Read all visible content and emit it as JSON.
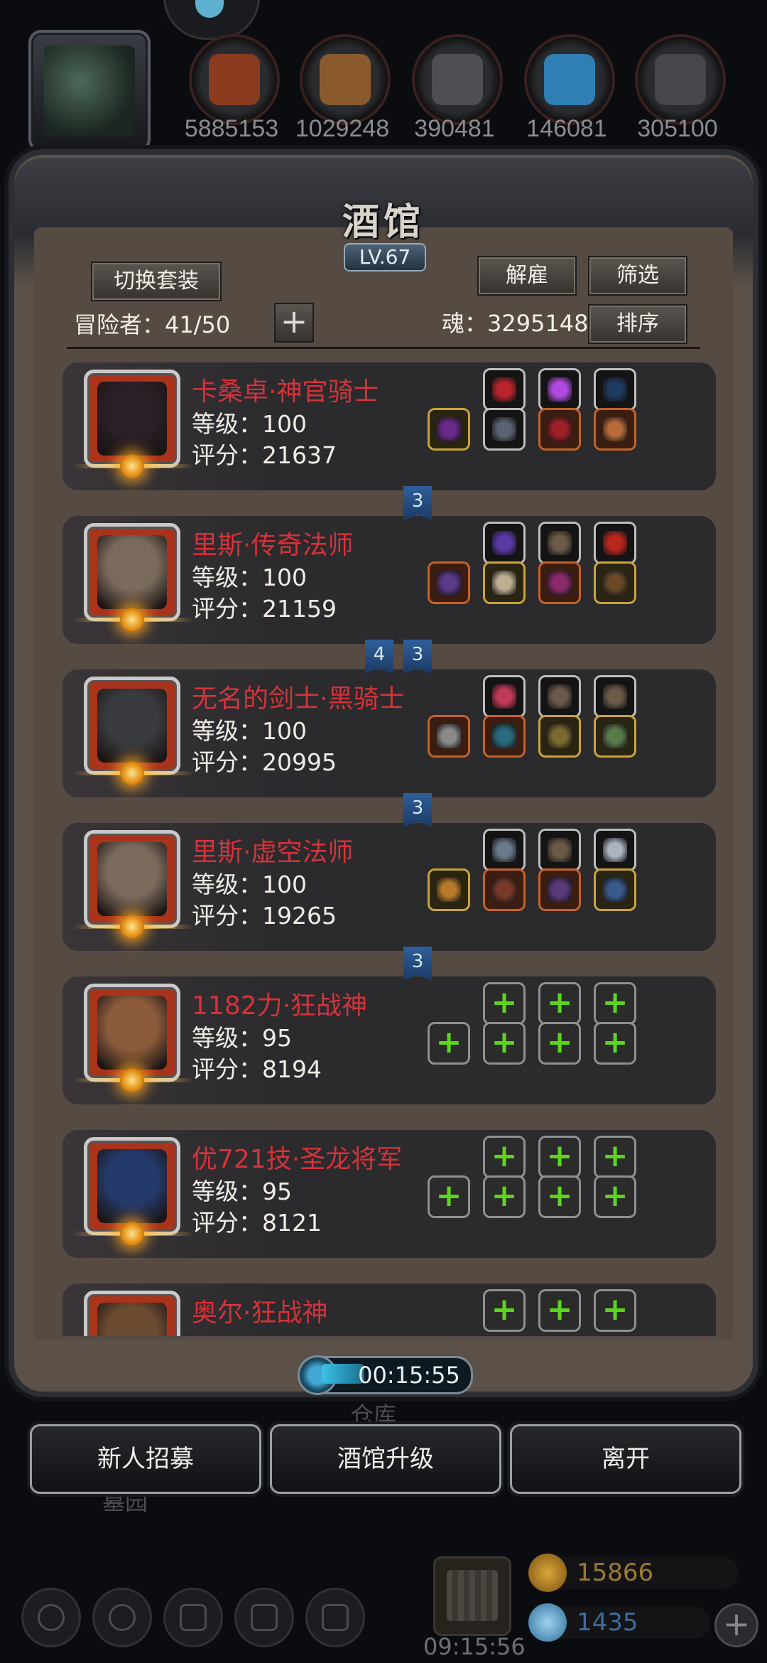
{
  "resources": {
    "values": [
      "5885153",
      "1029248",
      "390481",
      "146081",
      "305100"
    ],
    "icons": [
      "meat-icon",
      "wood-icon",
      "stone-icon",
      "crystal-icon",
      "iron-icon"
    ],
    "colors": [
      "#8a3b1e",
      "#8a5a2e",
      "#4e4f53",
      "#2f7fb5",
      "#45474b"
    ]
  },
  "panel": {
    "title": "酒馆",
    "level": "LV.67",
    "switch_set": "切换套装",
    "dismiss": "解雇",
    "filter": "筛选",
    "sort": "排序",
    "adventurers": "冒险者：41/50",
    "soul": "魂：3295148"
  },
  "heroes": [
    {
      "name": "卡桑卓·神官骑士",
      "level": "等级：100",
      "score": "评分：21637",
      "face": "#2a1f26",
      "top": [
        {
          "t": "",
          "c": "#b8242b"
        },
        {
          "t": "",
          "c": "#b04ae0"
        },
        {
          "t": "",
          "c": "#1e3a5e"
        }
      ],
      "bottom": [
        {
          "t": "gold",
          "c": "#6a2a8a"
        },
        {
          "t": "",
          "c": "#5b6272"
        },
        {
          "t": "red",
          "c": "#a01e28"
        },
        {
          "t": "red",
          "c": "#b86a3a"
        }
      ]
    },
    {
      "name": "里斯·传奇法师",
      "level": "等级：100",
      "score": "评分：21159",
      "face": "#7a6a5c",
      "top": [
        {
          "t": "",
          "c": "#5a3aa8"
        },
        {
          "t": "",
          "c": "#6b5a48"
        },
        {
          "t": "",
          "c": "#b8261e"
        }
      ],
      "bottom": [
        {
          "t": "red",
          "c": "#5a3a8a"
        },
        {
          "t": "gold",
          "c": "#bfae92"
        },
        {
          "t": "red",
          "c": "#8a2a6a"
        },
        {
          "t": "gold",
          "c": "#6a4a26"
        }
      ]
    },
    {
      "name": "无名的剑士·黑骑士",
      "level": "等级：100",
      "score": "评分：20995",
      "face": "#3a3b3f",
      "top": [
        {
          "t": "",
          "c": "#c23a5a"
        },
        {
          "t": "",
          "c": "#6b5a48"
        },
        {
          "t": "",
          "c": "#6b5a48"
        }
      ],
      "bottom": [
        {
          "t": "red",
          "c": "#8a8a8a"
        },
        {
          "t": "red",
          "c": "#2a6a7a"
        },
        {
          "t": "gold",
          "c": "#7a6a30"
        },
        {
          "t": "gold",
          "c": "#5a7a4a"
        }
      ]
    },
    {
      "name": "里斯·虚空法师",
      "level": "等级：100",
      "score": "评分：19265",
      "face": "#7a6a5c",
      "top": [
        {
          "t": "",
          "c": "#6a7a8a"
        },
        {
          "t": "",
          "c": "#6b5a48"
        },
        {
          "t": "",
          "c": "#aab4c0"
        }
      ],
      "bottom": [
        {
          "t": "gold",
          "c": "#b87a2a"
        },
        {
          "t": "red",
          "c": "#7a3a2a"
        },
        {
          "t": "red",
          "c": "#5a3a7a"
        },
        {
          "t": "gold",
          "c": "#3a5a8a"
        }
      ]
    },
    {
      "name": "1182力·狂战神",
      "level": "等级：95",
      "score": "评分：8194",
      "face": "#8a5a3a"
    },
    {
      "name": "优721技·圣龙将军",
      "level": "等级：95",
      "score": "评分：8121",
      "face": "#243a6a"
    },
    {
      "name": "奥尔·狂战神",
      "level": "",
      "score": "",
      "face": "#6a4a30"
    }
  ],
  "badges": [
    {
      "labels": [
        "3"
      ]
    },
    {
      "labels": [
        "4",
        "3"
      ]
    },
    {
      "labels": [
        "3"
      ]
    },
    {
      "labels": [
        "3"
      ]
    }
  ],
  "timer": "00:15:55",
  "background_labels": {
    "warehouse": "仓库",
    "cemetery": "墓园"
  },
  "buttons": {
    "recruit": "新人招募",
    "upgrade": "酒馆升级",
    "leave": "离开"
  },
  "bottom": {
    "time": "09:15:56",
    "gold": "15866",
    "gems": "1435"
  },
  "colors": {
    "hero_name": "#d5333a",
    "plus_green": "#5dd41d",
    "badge_blue": "#2f5f9c"
  }
}
